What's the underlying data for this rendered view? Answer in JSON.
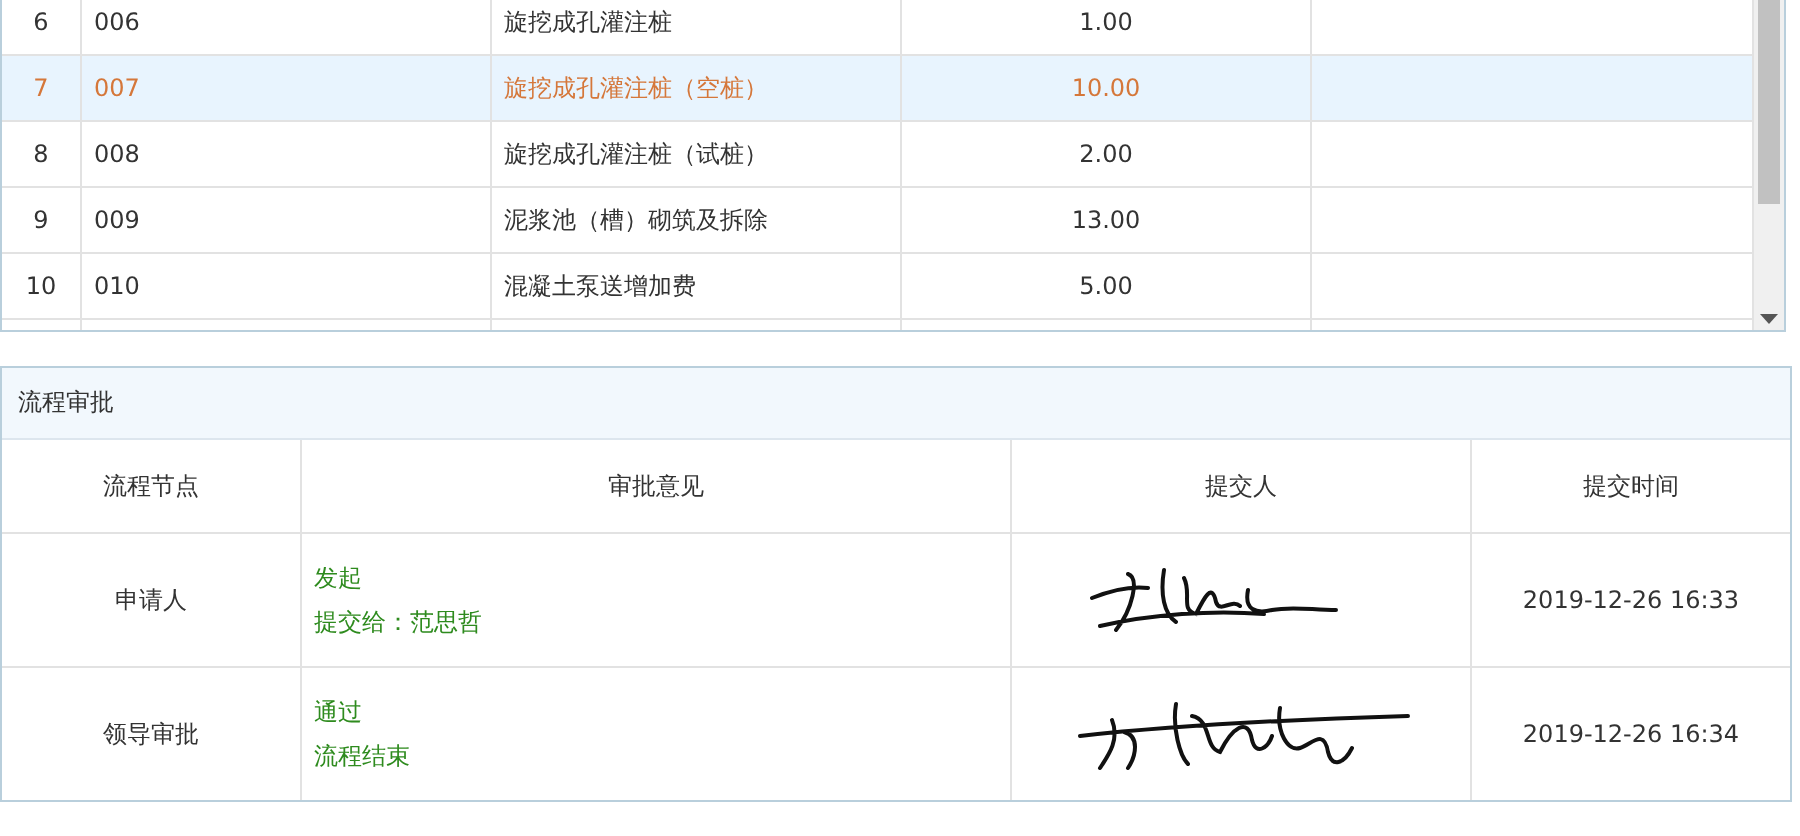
{
  "item_table": {
    "rows": [
      {
        "index": "6",
        "code": "006",
        "name": "旋挖成孔灌注桩",
        "quantity": "1.00",
        "selected": false
      },
      {
        "index": "7",
        "code": "007",
        "name": "旋挖成孔灌注桩（空桩）",
        "quantity": "10.00",
        "selected": true
      },
      {
        "index": "8",
        "code": "008",
        "name": "旋挖成孔灌注桩（试桩）",
        "quantity": "2.00",
        "selected": false
      },
      {
        "index": "9",
        "code": "009",
        "name": "泥浆池（槽）砌筑及拆除",
        "quantity": "13.00",
        "selected": false
      },
      {
        "index": "10",
        "code": "010",
        "name": "混凝土泵送增加费",
        "quantity": "5.00",
        "selected": false
      }
    ]
  },
  "approval_panel": {
    "title": "流程审批",
    "columns": [
      "流程节点",
      "审批意见",
      "提交人",
      "提交时间"
    ],
    "rows": [
      {
        "node": "申请人",
        "opinion": [
          "发起",
          "提交给：范思哲"
        ],
        "time": "2019-12-26 16:33"
      },
      {
        "node": "领导审批",
        "opinion": [
          "通过",
          "流程结束"
        ],
        "time": "2019-12-26 16:34"
      }
    ]
  }
}
